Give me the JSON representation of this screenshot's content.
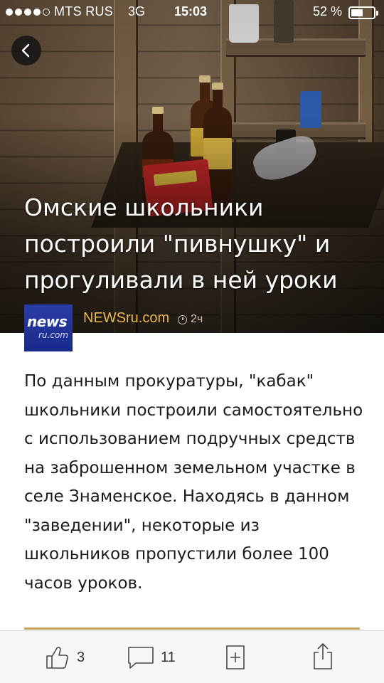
{
  "status_bar": {
    "carrier": "MTS RUS",
    "network": "3G",
    "time": "15:03",
    "battery_text": "52 %",
    "battery_level": 0.52,
    "signal_bars_filled": 4,
    "signal_bars_total": 5
  },
  "article": {
    "headline": "Омские школьники построили \"пивнушку\" и прогуливали в ней уроки",
    "source": {
      "logo_line1": "news",
      "logo_line2": "ru.com",
      "name": "NEWSru.com",
      "time_ago": "2ч"
    },
    "body": "По данным прокуратуры, \"кабак\" школьники построили самостоятельно с использованием подручных средств на заброшенном земельном участке в селе Знаменское. Находясь в данном \"заведении\", некоторые из школьников пропустили более 100 часов уроков."
  },
  "toolbar": {
    "likes_count": "3",
    "comments_count": "11"
  },
  "icons": {
    "back": "chevron-left-icon",
    "like": "thumbs-up-icon",
    "comment": "comment-icon",
    "bookmark": "bookmark-add-icon",
    "share": "share-icon",
    "clock": "clock-icon"
  },
  "colors": {
    "source_name": "#e8b84a",
    "logo_bg": "#1f2f96",
    "accent_divider": "#c9a25e"
  }
}
